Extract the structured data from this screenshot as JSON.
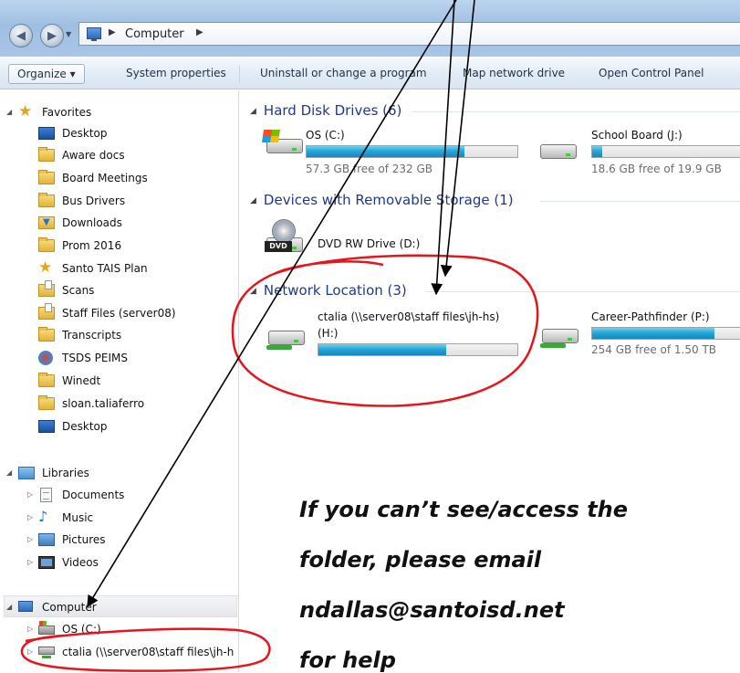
{
  "address_bar": {
    "path": [
      "Computer"
    ]
  },
  "toolbar": {
    "organize": "Organize ▾",
    "system_properties": "System properties",
    "uninstall": "Uninstall or change a program",
    "map_drive": "Map network drive",
    "control_panel": "Open Control Panel"
  },
  "nav": {
    "favorites_header": "Favorites",
    "favorites": [
      "Desktop",
      "Aware docs",
      "Board Meetings",
      "Bus Drivers",
      "Downloads",
      "Prom 2016",
      "Santo TAIS Plan",
      "Scans",
      "Staff Files (server08)",
      "Transcripts",
      "TSDS PEIMS",
      "Winedt",
      "sloan.taliaferro",
      "Desktop"
    ],
    "libraries_header": "Libraries",
    "libraries": [
      "Documents",
      "Music",
      "Pictures",
      "Videos"
    ],
    "computer_header": "Computer",
    "computer_items": [
      "OS (C:)",
      "ctalia (\\\\server08\\staff files\\jh-h"
    ]
  },
  "content": {
    "hard_disks": {
      "header": "Hard Disk Drives (6)",
      "drives": [
        {
          "name": "OS (C:)",
          "free": "57.3 GB free of 232 GB",
          "used_fraction": 0.75
        },
        {
          "name": "School Board (J:)",
          "free": "18.6 GB free of 19.9 GB",
          "used_fraction": 0.07
        }
      ]
    },
    "removable": {
      "header": "Devices with Removable Storage (1)",
      "drives": [
        {
          "name": "DVD RW Drive (D:)",
          "badge": "DVD"
        }
      ]
    },
    "network": {
      "header": "Network Location (3)",
      "drives": [
        {
          "name": "ctalia (\\\\server08\\staff files\\jh-hs)",
          "letter": "(H:)",
          "used_fraction": 0.64
        },
        {
          "name": "Career-Pathfinder (P:)",
          "free": "254 GB free of 1.50 TB",
          "used_fraction": 0.83
        }
      ]
    }
  },
  "callout": {
    "lines": [
      "If you can’t see/access the",
      "folder, please email",
      "ndallas@santoisd.net",
      "for help"
    ]
  },
  "colors": {
    "annotation_red": "#e8141c",
    "capacity_blue": "#1f9bd2",
    "group_header": "#1e3a8c"
  }
}
